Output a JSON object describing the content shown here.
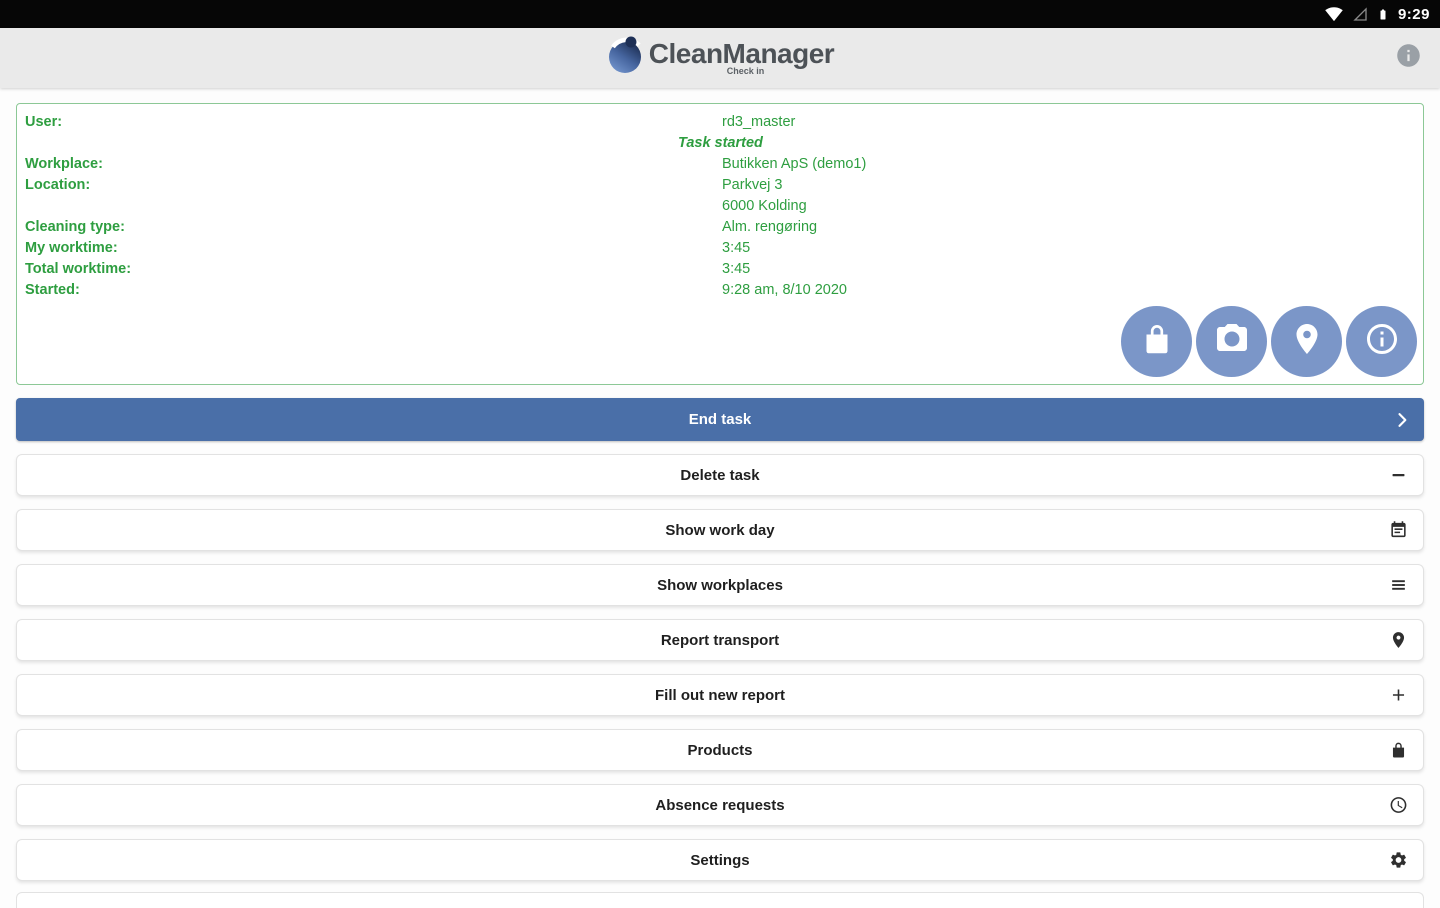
{
  "status_bar": {
    "time": "9:29",
    "icons": [
      "wifi-icon",
      "cellular-icon",
      "battery-icon"
    ]
  },
  "header": {
    "app_name": "CleanManager",
    "subtitle": "Check in",
    "info_icon": "info-icon"
  },
  "task_card": {
    "rows": [
      {
        "label": "User:",
        "value": "rd3_master"
      },
      {
        "label": "",
        "value": "Task started"
      },
      {
        "label": "Workplace:",
        "value": "Butikken ApS (demo1)"
      },
      {
        "label": "Location:",
        "value": "Parkvej 3"
      },
      {
        "label": "",
        "value": "6000 Kolding"
      },
      {
        "label": "Cleaning type:",
        "value": "Alm. rengøring"
      },
      {
        "label": "My worktime:",
        "value": "3:45"
      },
      {
        "label": "Total worktime:",
        "value": "3:45"
      },
      {
        "label": "Started:",
        "value": "9:28 am, 8/10 2020"
      }
    ],
    "action_icons": [
      "shopping-bag",
      "camera",
      "location-pin",
      "info"
    ],
    "colors": {
      "text": "#2e9e40",
      "border": "#8cc896",
      "circle_button": "#7b96c8"
    }
  },
  "primary_button": {
    "label": "End task",
    "color": "#4a6fa8"
  },
  "menu_buttons": [
    {
      "label": "Delete task",
      "icon": "minus"
    },
    {
      "label": "Show work day",
      "icon": "calendar"
    },
    {
      "label": "Show workplaces",
      "icon": "list"
    },
    {
      "label": "Report transport",
      "icon": "location-pin"
    },
    {
      "label": "Fill out new report",
      "icon": "plus"
    },
    {
      "label": "Products",
      "icon": "shopping-bag"
    },
    {
      "label": "Absence requests",
      "icon": "clock"
    },
    {
      "label": "Settings",
      "icon": "gear"
    }
  ]
}
